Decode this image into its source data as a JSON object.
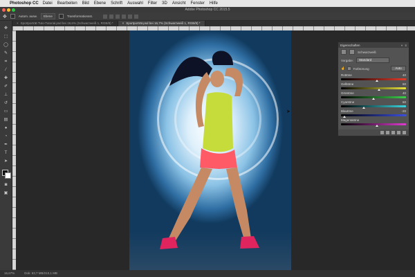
{
  "menubar": {
    "app_name": "Photoshop CC",
    "items": [
      "Datei",
      "Bearbeiten",
      "Bild",
      "Ebene",
      "Schrift",
      "Auswahl",
      "Filter",
      "3D",
      "Ansicht",
      "Fenster",
      "Hilfe"
    ]
  },
  "window": {
    "title": "Adobe Photoshop CC 2015.5"
  },
  "options": {
    "auto_select_label": "Autom. ausw.",
    "auto_select_value": "Ebene",
    "transform_label": "Transformationsst."
  },
  "tabs": [
    {
      "label": "Sportporträt-Tuto-Tutorial.psd bei 19,6% (Schwarzweiß 1, RGB/8) *",
      "active": false
    },
    {
      "label": "Sportporträt.psd bei 16,7% (Schwarzweiß 1, RGB/8) *",
      "active": true
    }
  ],
  "properties_panel": {
    "title": "Eigenschaften",
    "layer_name": "Schwarzweiß",
    "preset_label": "Vorgabe:",
    "preset_value": "Standard",
    "tint_label": "Farbtonung",
    "auto_label": "Auto",
    "sliders": [
      {
        "label": "Rottöne",
        "value": "40",
        "thumb": 0.55,
        "gradient": "linear-gradient(90deg,#000,#e53b2b)"
      },
      {
        "label": "Gelbtöne",
        "value": "60",
        "thumb": 0.58,
        "gradient": "linear-gradient(90deg,#000,#e8e23b)"
      },
      {
        "label": "Grüntöne",
        "value": "40",
        "thumb": 0.5,
        "gradient": "linear-gradient(90deg,#000,#3bd04a)"
      },
      {
        "label": "Cyantöne",
        "value": "60",
        "thumb": 0.35,
        "gradient": "linear-gradient(90deg,#000,#39d6e0)"
      },
      {
        "label": "Blautöne",
        "value": "-20",
        "thumb": 0.05,
        "gradient": "linear-gradient(90deg,#000,#3a4fe0)"
      },
      {
        "label": "Magentatöne",
        "value": "",
        "thumb": 0.55,
        "gradient": "linear-gradient(90deg,#000,#e03ad0)"
      }
    ]
  },
  "status": {
    "zoom": "16,67%",
    "doc": "Dok: 63,7 MB/210,1 MB"
  },
  "colors": {
    "accent": "#1f6fd6",
    "mac_close": "#ff5f57",
    "mac_min": "#febc2e",
    "mac_max": "#28c840"
  }
}
